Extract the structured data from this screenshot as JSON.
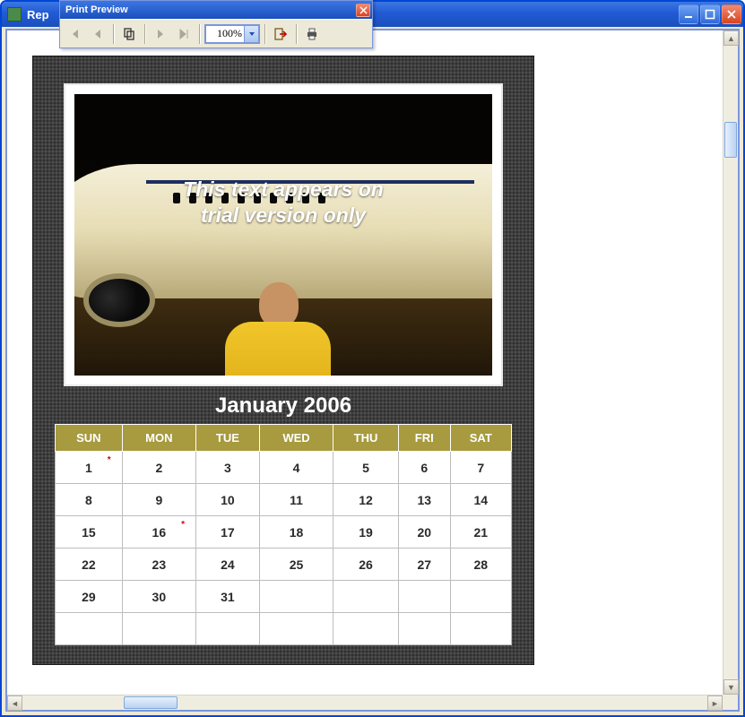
{
  "parent": {
    "title": "Rep"
  },
  "preview": {
    "title": "Print Preview",
    "zoom": "100%"
  },
  "watermark": {
    "line1": "This text appears on",
    "line2": "trial version only"
  },
  "calendar": {
    "month_title": "January 2006",
    "headers": [
      "SUN",
      "MON",
      "TUE",
      "WED",
      "THU",
      "FRI",
      "SAT"
    ],
    "weeks": [
      [
        {
          "d": "1",
          "m": true
        },
        {
          "d": "2"
        },
        {
          "d": "3"
        },
        {
          "d": "4"
        },
        {
          "d": "5"
        },
        {
          "d": "6"
        },
        {
          "d": "7"
        }
      ],
      [
        {
          "d": "8"
        },
        {
          "d": "9"
        },
        {
          "d": "10"
        },
        {
          "d": "11"
        },
        {
          "d": "12"
        },
        {
          "d": "13"
        },
        {
          "d": "14"
        }
      ],
      [
        {
          "d": "15"
        },
        {
          "d": "16",
          "m": true
        },
        {
          "d": "17"
        },
        {
          "d": "18"
        },
        {
          "d": "19"
        },
        {
          "d": "20"
        },
        {
          "d": "21"
        }
      ],
      [
        {
          "d": "22"
        },
        {
          "d": "23"
        },
        {
          "d": "24"
        },
        {
          "d": "25"
        },
        {
          "d": "26"
        },
        {
          "d": "27"
        },
        {
          "d": "28"
        }
      ],
      [
        {
          "d": "29"
        },
        {
          "d": "30"
        },
        {
          "d": "31"
        },
        {
          "d": ""
        },
        {
          "d": ""
        },
        {
          "d": ""
        },
        {
          "d": ""
        }
      ],
      [
        {
          "d": ""
        },
        {
          "d": ""
        },
        {
          "d": ""
        },
        {
          "d": ""
        },
        {
          "d": ""
        },
        {
          "d": ""
        },
        {
          "d": ""
        }
      ]
    ]
  }
}
